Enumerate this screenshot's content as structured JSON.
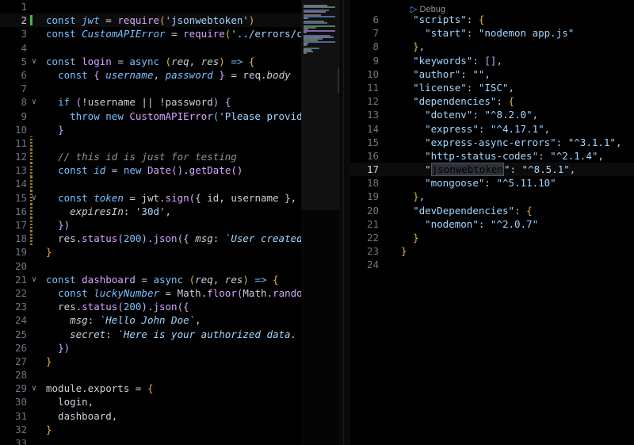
{
  "left_editor": {
    "current_line": 2,
    "lines": [
      {
        "n": "1",
        "tokens": []
      },
      {
        "n": "2",
        "tokens": [
          [
            "kw",
            "const "
          ],
          [
            "var",
            "jwt"
          ],
          [
            "pl",
            " = "
          ],
          [
            "fn",
            "require"
          ],
          [
            "gold",
            "("
          ],
          [
            "str",
            "'jsonwebtoken'"
          ],
          [
            "gold",
            ")"
          ]
        ]
      },
      {
        "n": "3",
        "tokens": [
          [
            "kw",
            "const "
          ],
          [
            "var",
            "CustomAPIError"
          ],
          [
            "pl",
            " = "
          ],
          [
            "fn",
            "require"
          ],
          [
            "gold",
            "("
          ],
          [
            "str",
            "'../errors/custo"
          ]
        ]
      },
      {
        "n": "4",
        "tokens": []
      },
      {
        "n": "5",
        "tokens": [
          [
            "kw",
            "const "
          ],
          [
            "fn",
            "login"
          ],
          [
            "pl",
            " = "
          ],
          [
            "kw",
            "async "
          ],
          [
            "gold",
            "("
          ],
          [
            "ital",
            "req"
          ],
          [
            "pl",
            ", "
          ],
          [
            "ital",
            "res"
          ],
          [
            "gold",
            ")"
          ],
          [
            "kw",
            " => "
          ],
          [
            "gold",
            "{"
          ]
        ]
      },
      {
        "n": "6",
        "tokens": [
          [
            "pl",
            "  "
          ],
          [
            "kw",
            "const "
          ],
          [
            "fn",
            "{ "
          ],
          [
            "var",
            "username"
          ],
          [
            "pl",
            ", "
          ],
          [
            "var",
            "password"
          ],
          [
            "fn",
            " }"
          ],
          [
            "pl",
            " = req."
          ],
          [
            "ital",
            "body"
          ]
        ]
      },
      {
        "n": "7",
        "tokens": []
      },
      {
        "n": "8",
        "tokens": [
          [
            "pl",
            "  "
          ],
          [
            "kw",
            "if "
          ],
          [
            "fn",
            "("
          ],
          [
            "pl",
            "!username || !password"
          ],
          [
            "fn",
            ")"
          ],
          [
            "pl",
            " "
          ],
          [
            "fn",
            "{"
          ]
        ]
      },
      {
        "n": "9",
        "tokens": [
          [
            "pl",
            "    "
          ],
          [
            "kw",
            "throw new "
          ],
          [
            "fn",
            "CustomAPIError"
          ],
          [
            "kw",
            "("
          ],
          [
            "str",
            "'Please provide em"
          ]
        ]
      },
      {
        "n": "10",
        "tokens": [
          [
            "pl",
            "  "
          ],
          [
            "fn",
            "}"
          ]
        ]
      },
      {
        "n": "11",
        "tokens": []
      },
      {
        "n": "12",
        "tokens": [
          [
            "pl",
            "  "
          ],
          [
            "cm",
            "// this id is just for testing"
          ]
        ]
      },
      {
        "n": "13",
        "tokens": [
          [
            "pl",
            "  "
          ],
          [
            "kw",
            "const "
          ],
          [
            "var",
            "id"
          ],
          [
            "pl",
            " = "
          ],
          [
            "kw",
            "new "
          ],
          [
            "fn",
            "Date"
          ],
          [
            "fn",
            "()"
          ],
          [
            "pl",
            "."
          ],
          [
            "fn",
            "getDate"
          ],
          [
            "fn",
            "()"
          ]
        ]
      },
      {
        "n": "14",
        "tokens": []
      },
      {
        "n": "15",
        "tokens": [
          [
            "pl",
            "  "
          ],
          [
            "kw",
            "const "
          ],
          [
            "var",
            "token"
          ],
          [
            "pl",
            " = jwt."
          ],
          [
            "fn",
            "sign"
          ],
          [
            "fn",
            "("
          ],
          [
            "pl",
            "{ id, username }, proc"
          ]
        ]
      },
      {
        "n": "16",
        "tokens": [
          [
            "pl",
            "    "
          ],
          [
            "ital",
            "expiresIn"
          ],
          [
            "pl",
            ": "
          ],
          [
            "str",
            "'30d'"
          ],
          [
            "pl",
            ","
          ]
        ]
      },
      {
        "n": "17",
        "tokens": [
          [
            "pl",
            "  "
          ],
          [
            "fn",
            "})"
          ]
        ]
      },
      {
        "n": "18",
        "tokens": [
          [
            "pl",
            "  res."
          ],
          [
            "fn",
            "status"
          ],
          [
            "fn",
            "("
          ],
          [
            "num",
            "200"
          ],
          [
            "fn",
            ")"
          ],
          [
            "pl",
            "."
          ],
          [
            "fn",
            "json"
          ],
          [
            "fn",
            "("
          ],
          [
            "pl",
            "{ "
          ],
          [
            "ital",
            "msg"
          ],
          [
            "pl",
            ": "
          ],
          [
            "tpl",
            "`User created`"
          ],
          [
            "pl",
            ", t"
          ]
        ]
      },
      {
        "n": "19",
        "tokens": [
          [
            "gold",
            "}"
          ]
        ]
      },
      {
        "n": "20",
        "tokens": []
      },
      {
        "n": "21",
        "tokens": [
          [
            "kw",
            "const "
          ],
          [
            "fn",
            "dashboard"
          ],
          [
            "pl",
            " = "
          ],
          [
            "kw",
            "async "
          ],
          [
            "gold",
            "("
          ],
          [
            "ital",
            "req"
          ],
          [
            "pl",
            ", "
          ],
          [
            "ital",
            "res"
          ],
          [
            "gold",
            ")"
          ],
          [
            "kw",
            " => "
          ],
          [
            "gold",
            "{"
          ]
        ]
      },
      {
        "n": "22",
        "tokens": [
          [
            "pl",
            "  "
          ],
          [
            "kw",
            "const "
          ],
          [
            "var",
            "luckyNumber"
          ],
          [
            "pl",
            " = Math."
          ],
          [
            "fn",
            "floor"
          ],
          [
            "fn",
            "("
          ],
          [
            "pl",
            "Math."
          ],
          [
            "fn",
            "random"
          ],
          [
            "kw",
            "()"
          ]
        ]
      },
      {
        "n": "23",
        "tokens": [
          [
            "pl",
            "  res."
          ],
          [
            "fn",
            "status"
          ],
          [
            "fn",
            "("
          ],
          [
            "num",
            "200"
          ],
          [
            "fn",
            ")"
          ],
          [
            "pl",
            "."
          ],
          [
            "fn",
            "json"
          ],
          [
            "fn",
            "({"
          ]
        ]
      },
      {
        "n": "24",
        "tokens": [
          [
            "pl",
            "    "
          ],
          [
            "ital",
            "msg"
          ],
          [
            "pl",
            ": "
          ],
          [
            "tpl",
            "`Hello John Doe`"
          ],
          [
            "pl",
            ","
          ]
        ]
      },
      {
        "n": "25",
        "tokens": [
          [
            "pl",
            "    "
          ],
          [
            "ital",
            "secret"
          ],
          [
            "pl",
            ": "
          ],
          [
            "tpl",
            "`Here is your authorized data. Your"
          ]
        ]
      },
      {
        "n": "26",
        "tokens": [
          [
            "pl",
            "  "
          ],
          [
            "fn",
            "})"
          ]
        ]
      },
      {
        "n": "27",
        "tokens": [
          [
            "gold",
            "}"
          ]
        ]
      },
      {
        "n": "28",
        "tokens": []
      },
      {
        "n": "29",
        "tokens": [
          [
            "pl",
            "module.exports = "
          ],
          [
            "gold",
            "{"
          ]
        ]
      },
      {
        "n": "30",
        "tokens": [
          [
            "pl",
            "  login,"
          ]
        ]
      },
      {
        "n": "31",
        "tokens": [
          [
            "pl",
            "  dashboard,"
          ]
        ]
      },
      {
        "n": "32",
        "tokens": [
          [
            "gold",
            "}"
          ]
        ]
      },
      {
        "n": "33",
        "tokens": []
      }
    ]
  },
  "right_editor": {
    "codelens": "Debug",
    "current_line": 17,
    "lines": [
      {
        "n": "6",
        "tokens": [
          [
            "pl",
            "  "
          ],
          [
            "str",
            "\"scripts\""
          ],
          [
            "pl",
            ": "
          ],
          [
            "gold",
            "{"
          ]
        ]
      },
      {
        "n": "7",
        "tokens": [
          [
            "pl",
            "    "
          ],
          [
            "str",
            "\"start\""
          ],
          [
            "pl",
            ": "
          ],
          [
            "str",
            "\"nodemon app.js\""
          ]
        ]
      },
      {
        "n": "8",
        "tokens": [
          [
            "pl",
            "  "
          ],
          [
            "gold",
            "}"
          ],
          [
            "pl",
            ","
          ]
        ]
      },
      {
        "n": "9",
        "tokens": [
          [
            "pl",
            "  "
          ],
          [
            "str",
            "\"keywords\""
          ],
          [
            "pl",
            ": "
          ],
          [
            "fn",
            "[]"
          ],
          [
            "pl",
            ","
          ]
        ]
      },
      {
        "n": "10",
        "tokens": [
          [
            "pl",
            "  "
          ],
          [
            "str",
            "\"author\""
          ],
          [
            "pl",
            ": "
          ],
          [
            "str",
            "\"\""
          ],
          [
            "pl",
            ","
          ]
        ]
      },
      {
        "n": "11",
        "tokens": [
          [
            "pl",
            "  "
          ],
          [
            "str",
            "\"license\""
          ],
          [
            "pl",
            ": "
          ],
          [
            "str",
            "\"ISC\""
          ],
          [
            "pl",
            ","
          ]
        ]
      },
      {
        "n": "12",
        "tokens": [
          [
            "pl",
            "  "
          ],
          [
            "str",
            "\"dependencies\""
          ],
          [
            "pl",
            ": "
          ],
          [
            "gold",
            "{"
          ]
        ]
      },
      {
        "n": "13",
        "tokens": [
          [
            "pl",
            "    "
          ],
          [
            "str",
            "\"dotenv\""
          ],
          [
            "pl",
            ": "
          ],
          [
            "str",
            "\"^8.2.0\""
          ],
          [
            "pl",
            ","
          ]
        ]
      },
      {
        "n": "14",
        "tokens": [
          [
            "pl",
            "    "
          ],
          [
            "str",
            "\"express\""
          ],
          [
            "pl",
            ": "
          ],
          [
            "str",
            "\"^4.17.1\""
          ],
          [
            "pl",
            ","
          ]
        ]
      },
      {
        "n": "15",
        "tokens": [
          [
            "pl",
            "    "
          ],
          [
            "str",
            "\"express-async-errors\""
          ],
          [
            "pl",
            ": "
          ],
          [
            "str",
            "\"^3.1.1\""
          ],
          [
            "pl",
            ","
          ]
        ]
      },
      {
        "n": "16",
        "tokens": [
          [
            "pl",
            "    "
          ],
          [
            "str",
            "\"http-status-codes\""
          ],
          [
            "pl",
            ": "
          ],
          [
            "str",
            "\"^2.1.4\""
          ],
          [
            "pl",
            ","
          ]
        ]
      },
      {
        "n": "17",
        "tokens": [
          [
            "pl",
            "    "
          ],
          [
            "str",
            "\""
          ],
          [
            "hl",
            "jsonwebtoken"
          ],
          [
            "str",
            "\""
          ],
          [
            "pl",
            ": "
          ],
          [
            "str",
            "\"^8.5.1\""
          ],
          [
            "pl",
            ","
          ]
        ]
      },
      {
        "n": "18",
        "tokens": [
          [
            "pl",
            "    "
          ],
          [
            "str",
            "\"mongoose\""
          ],
          [
            "pl",
            ": "
          ],
          [
            "str",
            "\"^5.11.10\""
          ]
        ]
      },
      {
        "n": "19",
        "tokens": [
          [
            "pl",
            "  "
          ],
          [
            "gold",
            "}"
          ],
          [
            "pl",
            ","
          ]
        ]
      },
      {
        "n": "20",
        "tokens": [
          [
            "pl",
            "  "
          ],
          [
            "str",
            "\"devDependencies\""
          ],
          [
            "pl",
            ": "
          ],
          [
            "gold",
            "{"
          ]
        ]
      },
      {
        "n": "21",
        "tokens": [
          [
            "pl",
            "    "
          ],
          [
            "str",
            "\"nodemon\""
          ],
          [
            "pl",
            ": "
          ],
          [
            "str",
            "\"^2.0.7\""
          ]
        ]
      },
      {
        "n": "22",
        "tokens": [
          [
            "pl",
            "  "
          ],
          [
            "gold",
            "}"
          ]
        ]
      },
      {
        "n": "23",
        "tokens": [
          [
            "gold",
            "}"
          ]
        ]
      },
      {
        "n": "24",
        "tokens": []
      }
    ]
  }
}
